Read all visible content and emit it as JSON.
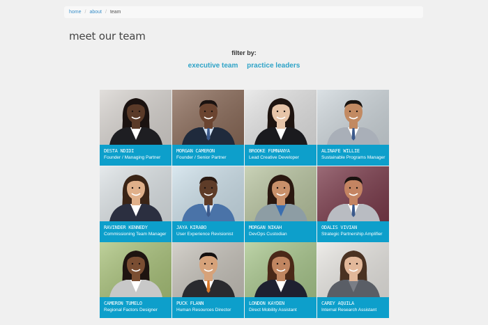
{
  "breadcrumb": {
    "home": "home",
    "about": "about",
    "current": "team",
    "separator": "/"
  },
  "page": {
    "title": "meet our team",
    "filter_label": "filter by:",
    "filters": [
      "executive team",
      "practice leaders"
    ]
  },
  "colors": {
    "accent": "#0d9fcb",
    "link": "#2ea3c7",
    "background": "#f0f0f0"
  },
  "team": [
    {
      "name": "DESTA NDIDI",
      "role": "Founder / Managing Partner",
      "skin": "#5a3a28",
      "hair": "#1a1210",
      "suit": "#1e1e22",
      "shirt": "#ffffff",
      "bg": "#d8d4d0"
    },
    {
      "name": "MORGAN CAMERON",
      "role": "Founder / Senior Partner",
      "skin": "#6b4430",
      "hair": "#1a1210",
      "suit": "#1f2a3c",
      "shirt": "#cfe0f2",
      "bg": "#8a6a58"
    },
    {
      "name": "BROOKE FUMNANYA",
      "role": "Lead Creative Developer",
      "skin": "#e6c4a8",
      "hair": "#1e1410",
      "suit": "#1a1a1e",
      "shirt": "#ffffff",
      "bg": "#e4e4e4"
    },
    {
      "name": "ALINAFE WILLIE",
      "role": "Sustainable Programs Manager",
      "skin": "#c28a62",
      "hair": "#1a1410",
      "suit": "#a9afb8",
      "shirt": "#ffffff",
      "bg": "#cfd7dc"
    },
    {
      "name": "RAVINDER KENNEDY",
      "role": "Commissioning Team Manager",
      "skin": "#e0b08a",
      "hair": "#3a2416",
      "suit": "#2b2f40",
      "shirt": "#ffffff",
      "bg": "#dde3e6"
    },
    {
      "name": "JAYA KIRABO",
      "role": "User Experience Revisionist",
      "skin": "#5e3c28",
      "hair": "#2a1a12",
      "suit": "#4a73a8",
      "shirt": "#d8e6f4",
      "bg": "#cde0ea"
    },
    {
      "name": "MORGAN NIKAH",
      "role": "DevOps Custodian",
      "skin": "#c9906a",
      "hair": "#2a1810",
      "suit": "#8d9da4",
      "shirt": "#3a6eb0",
      "bg": "#b8c4a0"
    },
    {
      "name": "ODALIS VIVIAN",
      "role": "Strategic Partnership Amplifier",
      "skin": "#c48462",
      "hair": "#1a1210",
      "suit": "#b9bcc2",
      "shirt": "#ffffff",
      "bg": "#7a3a4a"
    },
    {
      "name": "CAMERON TUMELO",
      "role": "Regional Factors Designer",
      "skin": "#7a4e32",
      "hair": "#1e1410",
      "suit": "#c8c8c8",
      "shirt": "#ffffff",
      "bg": "#a9c27a"
    },
    {
      "name": "PUCK FLANN",
      "role": "Human Resources Director",
      "skin": "#d6a27a",
      "hair": "#141010",
      "suit": "#2a2a2e",
      "shirt": "#ffffff",
      "bg": "#c6c2ba"
    },
    {
      "name": "LONDON KAYDEN",
      "role": "Direct Mobility Assistant",
      "skin": "#c08560",
      "hair": "#4a2818",
      "suit": "#1e2030",
      "shirt": "#ffffff",
      "bg": "#a8c68c"
    },
    {
      "name": "CAREY AQUILA",
      "role": "Internal Research Assistant",
      "skin": "#e2b89a",
      "hair": "#4a3222",
      "suit": "#5a5e66",
      "shirt": "#7a7e86",
      "bg": "#e8e6e2"
    }
  ]
}
